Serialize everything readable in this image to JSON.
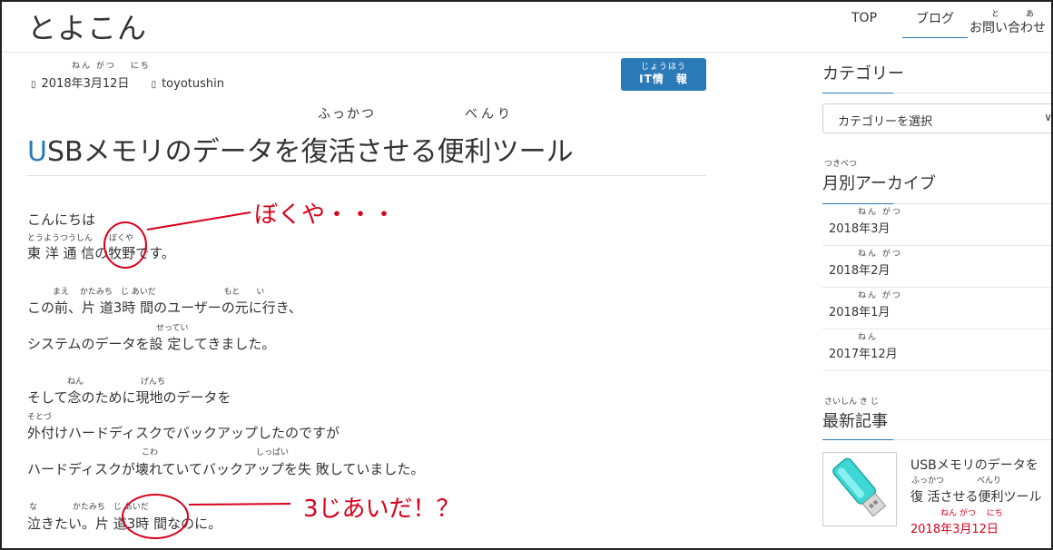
{
  "header": {
    "site_title": "とよこん",
    "nav": {
      "top": "TOP",
      "blog": "ブログ",
      "contact_ruby": "と　あ",
      "contact": "お問い合わせ"
    }
  },
  "post": {
    "date_ruby": "ねん がつ　 にち",
    "date": "2018年3月12日",
    "author": "toyotushin",
    "category_ruby": "じょうほう",
    "category": "IT情　報",
    "title_ruby_1": "ふっかつ",
    "title_ruby_2": "べんり",
    "title_first_letter": "U",
    "title_rest": "SBメモリのデータを復活させる便利ツール",
    "lines": [
      {
        "text": "こんにちは",
        "ruby": ""
      },
      {
        "text": "東 洋 通 信の牧野です。",
        "ruby": "とうようつうしん　　ぼくや"
      },
      {
        "text": "この前、片 道3時 間のユーザーの元に行き、",
        "ruby": "まえ　 かたみち　じ あいだ　　　　　　　　 もと　　い"
      },
      {
        "text": "システムのデータを設 定してきました。",
        "ruby": "せってい"
      },
      {
        "text": "そして念のために現地のデータを",
        "ruby": "ねん　　　　　　　げんち"
      },
      {
        "text": "外付けハードディスクでバックアップしたのですが",
        "ruby": "そとづ"
      },
      {
        "text": "ハードディスクが壊れていてバックアップを失 敗していました。",
        "ruby": "こわ　　　　　　　　　　　　しっぱい"
      },
      {
        "text": "泣きたい。片 道3時 間なのに。",
        "ruby": "な　　　　 かたみち　じ あいだ"
      }
    ]
  },
  "annotations": {
    "bokuya": "ぼくや・・・",
    "sanjiaida": "3じあいだ！？"
  },
  "sidebar": {
    "category_heading": "カテゴリー",
    "category_select": "カテゴリーを選択",
    "archive_ruby": "つきべつ",
    "archive_heading": "月別アーカイブ",
    "archive_item_ruby": [
      "ねん がつ",
      "ねん がつ",
      "ねん がつ",
      "ねん"
    ],
    "archives": [
      "2018年3月",
      "2018年2月",
      "2018年1月",
      "2017年12月"
    ],
    "recent_ruby": "さいしん き じ",
    "recent_heading": "最新記事",
    "recent_post": {
      "title_line1": "USBメモリのデータを",
      "ruby": "ふっかつ　　　　べんり",
      "title_line2": "復 活させる便利ツール",
      "date_ruby": "ねん がつ　 にち",
      "date": "2018年3月12日"
    }
  }
}
